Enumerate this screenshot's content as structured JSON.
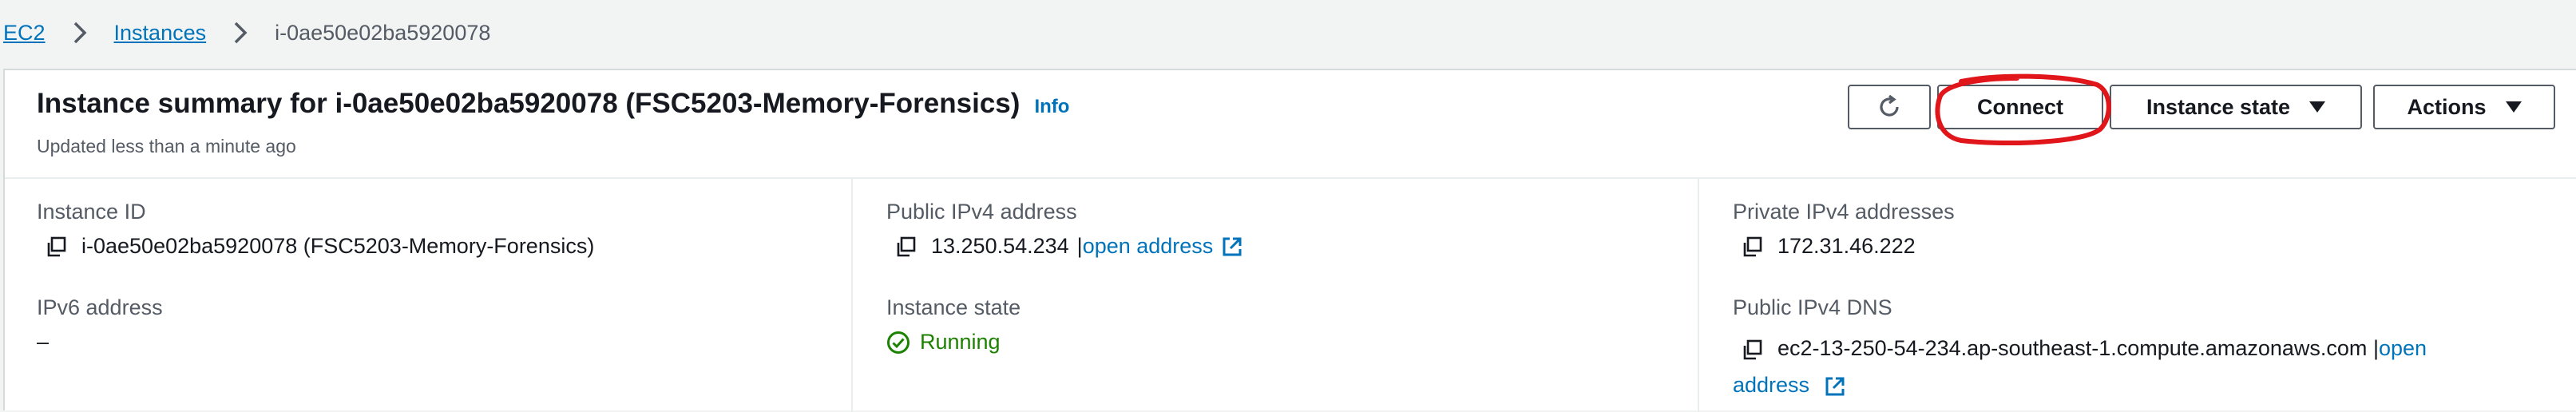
{
  "breadcrumb": {
    "items": [
      {
        "label": "EC2"
      },
      {
        "label": "Instances"
      }
    ],
    "current": "i-0ae50e02ba5920078"
  },
  "header": {
    "title": "Instance summary for i-0ae50e02ba5920078 (FSC5203-Memory-Forensics)",
    "info_label": "Info",
    "subtitle": "Updated less than a minute ago"
  },
  "toolbar": {
    "refresh_icon": "refresh-icon",
    "connect_label": "Connect",
    "instance_state_label": "Instance state",
    "actions_label": "Actions"
  },
  "details": {
    "instance_id_label": "Instance ID",
    "instance_id_value": "i-0ae50e02ba5920078 (FSC5203-Memory-Forensics)",
    "ipv6_label": "IPv6 address",
    "ipv6_value": "–",
    "public_ipv4_label": "Public IPv4 address",
    "public_ipv4_value": "13.250.54.234",
    "public_ipv4_separator": "|",
    "open_address_label": "open address",
    "instance_state_label": "Instance state",
    "instance_state_value": "Running",
    "private_ipv4_label": "Private IPv4 addresses",
    "private_ipv4_value": "172.31.46.222",
    "public_dns_label": "Public IPv4 DNS",
    "public_dns_value": "ec2-13-250-54-234.ap-southeast-1.compute.amazonaws.com",
    "public_dns_separator": "|",
    "public_dns_open_label_1": "open",
    "public_dns_open_label_2": "address"
  },
  "colors": {
    "link": "#0073bb",
    "running": "#1d8102",
    "annotation": "#e0161b"
  }
}
